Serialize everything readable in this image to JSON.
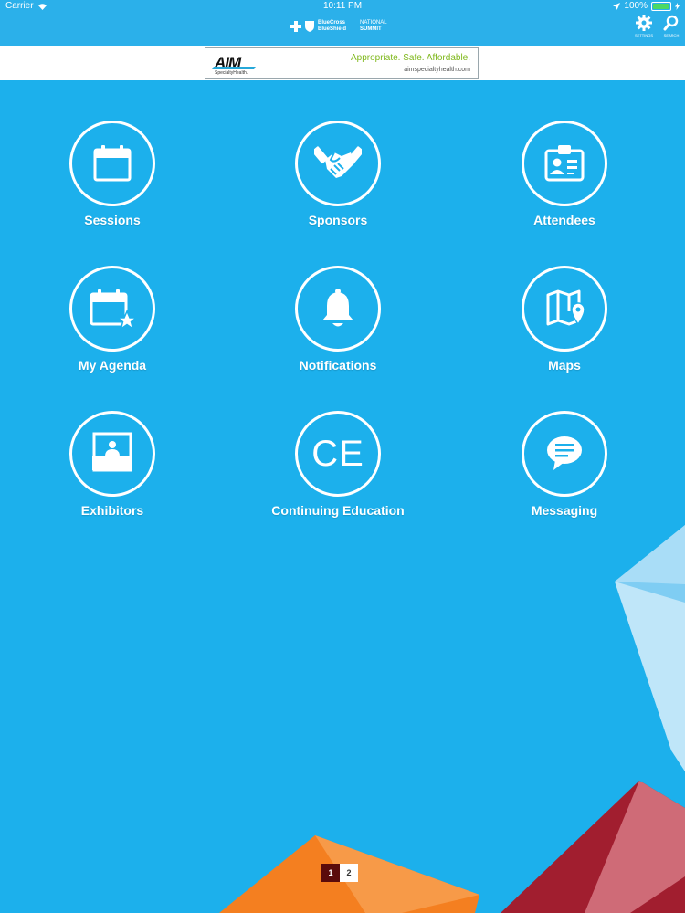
{
  "status_bar": {
    "carrier": "Carrier",
    "time": "10:11 PM",
    "battery": "100%"
  },
  "nav": {
    "brand_line1": "BlueCross",
    "brand_line2": "BlueShield",
    "event_line1": "NATIONAL",
    "event_line2": "SUMMIT",
    "settings_label": "SETTINGS",
    "search_label": "SEARCH"
  },
  "banner": {
    "logo": "AIM",
    "logo_sub": "SpecialtyHealth.",
    "tagline": "Appropriate. Safe. Affordable.",
    "url": "aimspecialtyhealth.com"
  },
  "tiles": [
    {
      "label": "Sessions",
      "icon": "calendar-icon"
    },
    {
      "label": "Sponsors",
      "icon": "handshake-icon"
    },
    {
      "label": "Attendees",
      "icon": "id-card-icon"
    },
    {
      "label": "My Agenda",
      "icon": "calendar-star-icon"
    },
    {
      "label": "Notifications",
      "icon": "bell-icon"
    },
    {
      "label": "Maps",
      "icon": "map-pin-icon"
    },
    {
      "label": "Exhibitors",
      "icon": "exhibitor-booth-icon"
    },
    {
      "label": "Continuing Education",
      "icon": "ce-icon",
      "glyph": "CE"
    },
    {
      "label": "Messaging",
      "icon": "chat-bubble-icon"
    }
  ],
  "pager": {
    "pages": [
      "1",
      "2"
    ],
    "current": 1
  },
  "colors": {
    "background": "#1cb0ec",
    "nav": "#2bb0ea",
    "page_active": "#5a0b0b",
    "deco_orange": "#f47f20",
    "deco_red": "#9b1b2b",
    "deco_light_blue": "#8fd1f5"
  }
}
